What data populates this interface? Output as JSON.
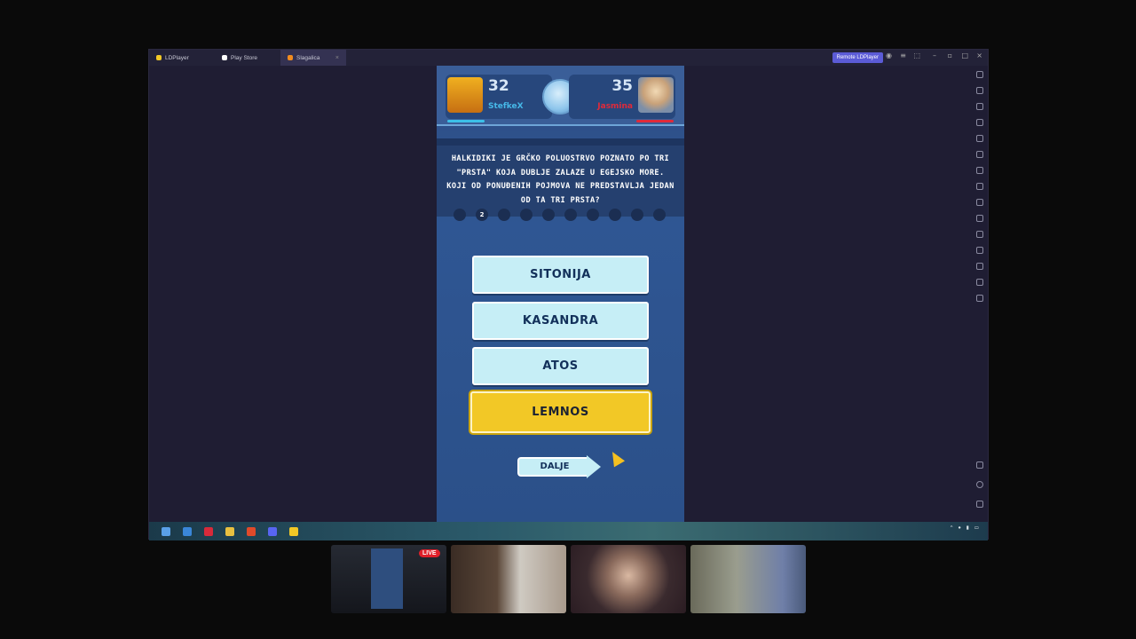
{
  "window": {
    "tabs": [
      {
        "label": "LDPlayer",
        "icon_color": "#f2c826"
      },
      {
        "label": "Play Store",
        "icon_color": "#ffffff"
      },
      {
        "label": "Slagalica",
        "icon_color": "#f28c1e"
      }
    ],
    "remote_button": "Remote LDPlayer"
  },
  "game": {
    "player1": {
      "score": "32",
      "name": "StefkeX",
      "color": "#46b8e8"
    },
    "player2": {
      "score": "35",
      "name": "Jasmina",
      "color": "#e02a3a"
    },
    "question": "HALKIDIKI JE GRČKO POLUOSTRVO POZNATO PO TRI \"PRSTA\" KOJA DUBLJE ZALAZE U EGEJSKO MORE. KOJI OD PONUĐENIH POJMOVA NE PREDSTAVLJA JEDAN OD TA TRI PRSTA?",
    "progress": {
      "current": "2",
      "total": 10
    },
    "answers": [
      "SITONIJA",
      "KASANDRA",
      "ATOS",
      "LEMNOS"
    ],
    "selected_answer": "LEMNOS",
    "next_button": "DALJE",
    "accent_yellow": "#f2c826"
  },
  "stream": {
    "live_badge": "LIVE"
  }
}
